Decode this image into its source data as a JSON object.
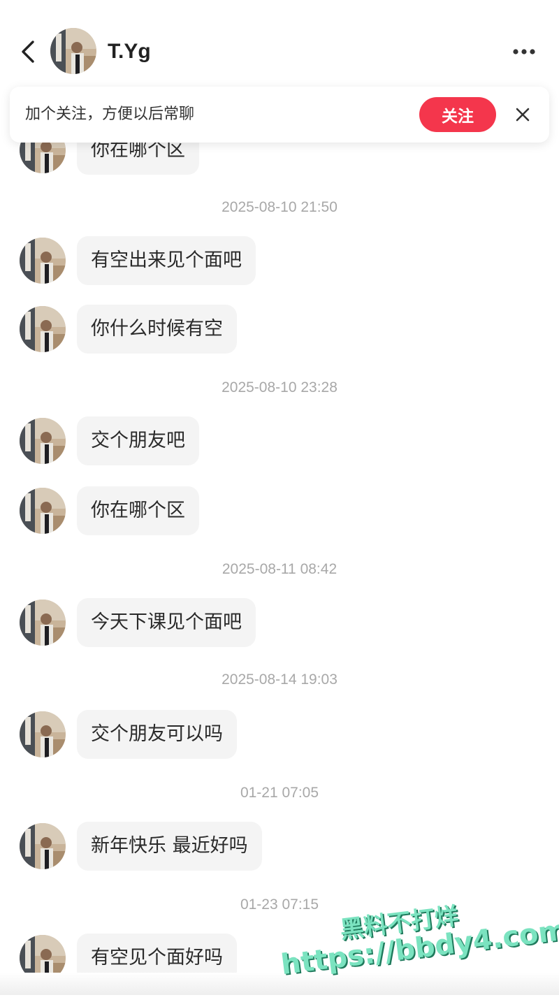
{
  "colors": {
    "follow_button": "#f4364c",
    "bubble_bg": "#f4f4f4",
    "timestamp": "#a8a8a8",
    "watermark": "#7be3c0"
  },
  "header": {
    "contact_name": "T.Yg",
    "back_icon": "chevron-left-icon",
    "more_icon": "more-horizontal-icon"
  },
  "follow_banner": {
    "text": "加个关注，方便以后常聊",
    "button_label": "关注",
    "close_icon": "close-icon"
  },
  "messages": [
    {
      "text": "你在哪个区"
    },
    {
      "timestamp": "2025-08-10 21:50"
    },
    {
      "text": "有空出来见个面吧"
    },
    {
      "text": "你什么时候有空"
    },
    {
      "timestamp": "2025-08-10 23:28"
    },
    {
      "text": "交个朋友吧"
    },
    {
      "text": "你在哪个区"
    },
    {
      "timestamp": "2025-08-11 08:42"
    },
    {
      "text": "今天下课见个面吧"
    },
    {
      "timestamp": "2025-08-14 19:03"
    },
    {
      "text": "交个朋友可以吗"
    },
    {
      "timestamp": "01-21 07:05"
    },
    {
      "text": "新年快乐 最近好吗"
    },
    {
      "timestamp": "01-23 07:15"
    },
    {
      "text": "有空见个面好吗"
    }
  ],
  "watermark": {
    "line1": "黑料不打烊",
    "line2": "https://bbdy4.com"
  }
}
